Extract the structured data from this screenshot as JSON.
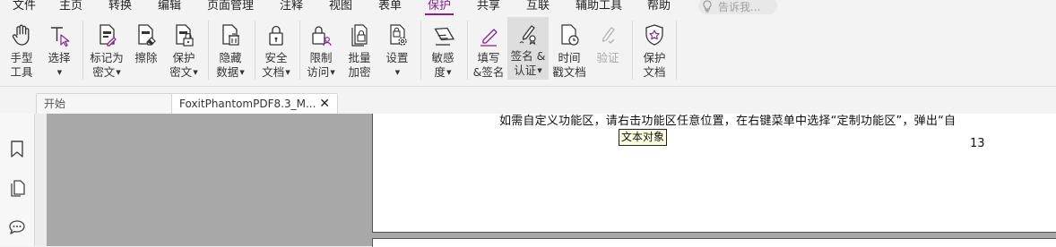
{
  "menu": {
    "items": [
      "文件",
      "主页",
      "转换",
      "编辑",
      "页面管理",
      "注释",
      "视图",
      "表单",
      "保护",
      "共享",
      "互联",
      "辅助工具",
      "帮助"
    ],
    "active": "保护",
    "tellme_placeholder": "告诉我..."
  },
  "ribbon": {
    "hand": "手型\n工具",
    "select": "选择",
    "mark_redact": "标记为\n密文",
    "erase": "擦除",
    "protect_redact": "保护\n密文",
    "hide_data": "隐藏\n数据",
    "secure_doc": "安全\n文档",
    "restrict_access": "限制\n访问",
    "batch_encrypt": "批量\n加密",
    "settings": "设置",
    "sensitivity": "敏感\n度",
    "fill_sign": "填写\n&签名",
    "sign_certify": "签名 &\n认证",
    "timestamp": "时间\n戳文档",
    "validate": "验证",
    "protect_doc": "保护\n文档"
  },
  "tabs": {
    "start": "开始",
    "document": "FoxitPhantomPDF8.3_M..."
  },
  "document": {
    "line": "如需自定义功能区，请右击功能区任意位置，在右键菜单中选择“定制功能区”，弹出“自",
    "tooltip": "文本对象",
    "page_number": "13"
  },
  "colors": {
    "accent": "#8a1f8f",
    "tooltip_bg": "#ffffe1",
    "gray_area": "#a8a8a8"
  }
}
